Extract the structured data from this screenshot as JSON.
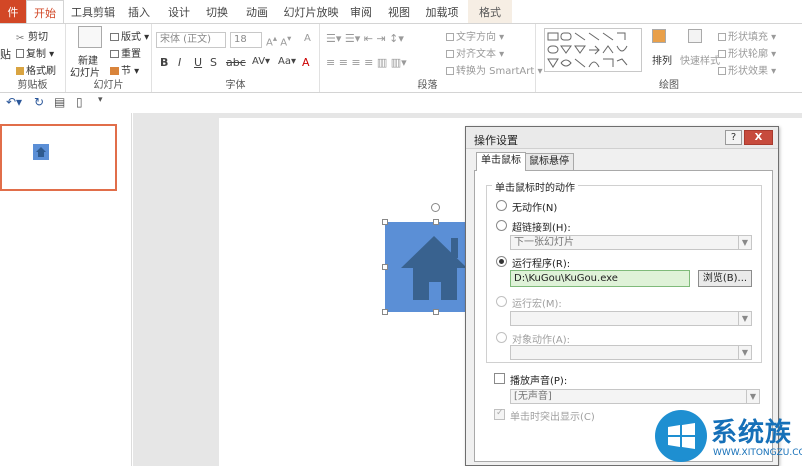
{
  "tabs": {
    "file": "件",
    "home": "开始",
    "toolbox": "工具剪辑",
    "insert": "插入",
    "design": "设计",
    "transitions": "切换",
    "animations": "动画",
    "slideshow": "幻灯片放映",
    "review": "审阅",
    "view": "视图",
    "addins": "加载项",
    "format": "格式"
  },
  "ribbon": {
    "clipboard": {
      "paste": "贴",
      "cut": "剪切",
      "copy": "复制",
      "format_painter": "格式刷",
      "label": "剪贴板"
    },
    "slides": {
      "new_slide_1": "新建",
      "new_slide_2": "幻灯片",
      "layout": "版式",
      "reset": "重置",
      "section": "节",
      "label": "幻灯片"
    },
    "font": {
      "font_name": "宋体 (正文)",
      "font_size": "18",
      "label": "字体"
    },
    "paragraph": {
      "text_direction": "文字方向",
      "align_text": "对齐文本",
      "smartart": "转换为 SmartArt",
      "label": "段落"
    },
    "drawing": {
      "arrange": "排列",
      "quick_styles": "快速样式",
      "shape_fill": "形状填充",
      "shape_outline": "形状轮廓",
      "shape_effects": "形状效果",
      "label": "绘图"
    }
  },
  "dialog": {
    "title": "操作设置",
    "help": "?",
    "close": "X",
    "tab_click": "单击鼠标",
    "tab_hover": "鼠标悬停",
    "group_title": "单击鼠标时的动作",
    "none_label": "无动作(N)",
    "hyperlink_label": "超链接到(H):",
    "hyperlink_value": "下一张幻灯片",
    "run_program_label": "运行程序(R):",
    "run_program_value": "D:\\KuGou\\KuGou.exe",
    "browse_button": "浏览(B)...",
    "run_macro_label": "运行宏(M):",
    "object_action_label": "对象动作(A):",
    "play_sound_label": "播放声音(P):",
    "sound_value": "[无声音]",
    "highlight_label": "单击时突出显示(C)"
  },
  "watermark": {
    "brand": "系统族",
    "url": "WWW.XITONGZU.COM"
  },
  "colors": {
    "accent": "#d24726",
    "shape_fill": "#5b8fd6",
    "run_program_field": "#dff2d8",
    "close_button": "#c74b3d"
  }
}
